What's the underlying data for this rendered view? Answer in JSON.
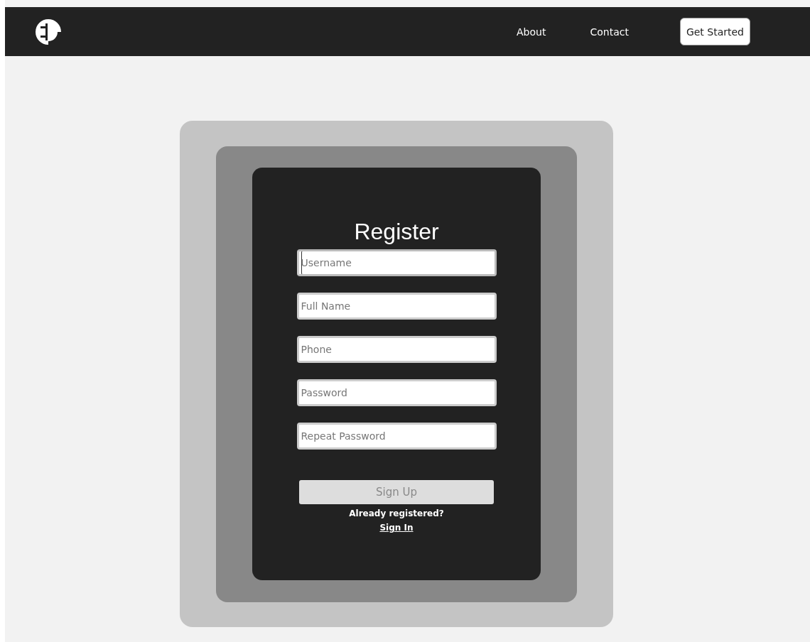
{
  "nav": {
    "links": [
      {
        "label": "About"
      },
      {
        "label": "Contact"
      }
    ],
    "cta": "Get Started"
  },
  "form": {
    "title": "Register",
    "fields": [
      {
        "placeholder": "Username",
        "focused": true
      },
      {
        "placeholder": "Full Name",
        "focused": false
      },
      {
        "placeholder": "Phone",
        "focused": false
      },
      {
        "placeholder": "Password",
        "focused": false
      },
      {
        "placeholder": "Repeat Password",
        "focused": false
      }
    ],
    "submit": {
      "label": "Sign Up",
      "disabled": true
    },
    "prompt": "Already registered?",
    "link": "Sign In"
  }
}
